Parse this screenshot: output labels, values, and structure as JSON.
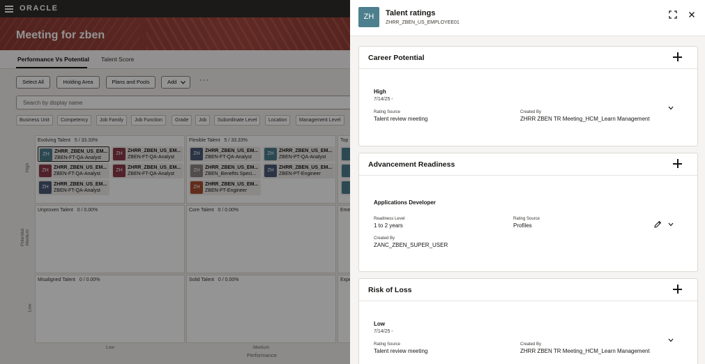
{
  "app": {
    "brand": "ORACLE",
    "page_title": "Meeting for zben"
  },
  "tabs": [
    {
      "label": "Performance Vs Potential"
    },
    {
      "label": "Talent Score"
    }
  ],
  "toolbar": {
    "select_all": "Select All",
    "holding_area": "Holding Area",
    "plans_and_pools": "Plans and Pools",
    "add": "Add",
    "more": "···"
  },
  "search": {
    "placeholder": "Search by display name"
  },
  "filters": [
    "Business Unit",
    "Competency",
    "Job Family",
    "Job Function",
    "Grade",
    "Job",
    "Subordinate Level",
    "Location",
    "Management Level"
  ],
  "grid": {
    "y_axis": "Potential",
    "x_axis": "Performance",
    "rows": [
      "High",
      "Medium",
      "Low"
    ],
    "cols": [
      "Low",
      "Medium"
    ],
    "cells": [
      {
        "label": "Evolving Talent",
        "count": "5 / 33.33%"
      },
      {
        "label": "Flexible Talent",
        "count": "5 / 33.33%"
      },
      {
        "label": "Top"
      },
      {
        "label": "Unproven Talent",
        "count": "0 / 0.00%"
      },
      {
        "label": "Core Talent",
        "count": "0 / 0.00%"
      },
      {
        "label": "Eme"
      },
      {
        "label": "Misaligned Talent",
        "count": "0 / 0.00%"
      },
      {
        "label": "Solid Talent",
        "count": "0 / 0.00%"
      },
      {
        "label": "Expe"
      }
    ],
    "cards": [
      {
        "initials": "ZH",
        "name": "ZHRR_ZBEN_US_EM...",
        "role": "ZBEN-FT-QA-Analyst",
        "color": "#4d7f8e"
      },
      {
        "initials": "ZH",
        "name": "ZHRR_ZBEN_US_EM...",
        "role": "ZBEN-FT-QA-Analyst",
        "color": "#8c3a48"
      },
      {
        "initials": "ZH",
        "name": "ZHRR_ZBEN_US_EM...",
        "role": "ZBEN-FT-QA-Analyst",
        "color": "#8c3a48"
      },
      {
        "initials": "ZH",
        "name": "ZHRR_ZBEN_US_EM...",
        "role": "ZBEN-FT-QA-Analyst",
        "color": "#8c3a48"
      },
      {
        "initials": "ZH",
        "name": "ZHRR_ZBEN_US_EM...",
        "role": "ZBEN-FT-QA-Analyst",
        "color": "#4a5a78"
      },
      {
        "initials": "ZH",
        "name": "ZHRR_ZBEN_US_EM...",
        "role": "ZBEN-FT-QA-Analyst",
        "color": "#4a5a78"
      },
      {
        "initials": "ZH",
        "name": "ZHRR_ZBEN_US_EM...",
        "role": "ZBEN-PT-QA-Analyst",
        "color": "#4d7f8e"
      },
      {
        "initials": "ZH",
        "name": "ZHRR_ZBEN_US_EM...",
        "role": "ZBEN_Benefits Speci...",
        "color": "#8a8580"
      },
      {
        "initials": "ZH",
        "name": "ZHRR_ZBEN_US_EM...",
        "role": "ZBEN-PT-Engineer",
        "color": "#4a5a78"
      },
      {
        "initials": "ZH",
        "name": "ZHRR_ZBEN_US_EM...",
        "role": "ZBEN-PT-Engineer",
        "color": "#a84e2e"
      }
    ]
  },
  "drawer": {
    "avatar": "ZH",
    "title": "Talent ratings",
    "subtitle": "ZHRR_ZBEN_US_EMPLOYEE01",
    "sections": {
      "career": {
        "title": "Career Potential",
        "value": "High",
        "date": "7/14/25 -",
        "rating_source_label": "Rating Source",
        "rating_source": "Talent review meeting",
        "created_by_label": "Created By",
        "created_by": "ZHRR ZBEN TR Meeting_HCM_Learn Management"
      },
      "advancement": {
        "title": "Advancement Readiness",
        "value": "Applications Developer",
        "readiness_label": "Readiness Level",
        "readiness": "1 to 2 years",
        "rating_source_label": "Rating Source",
        "rating_source": "Profiles",
        "created_by_label": "Created By",
        "created_by": "ZANC_ZBEN_SUPER_USER"
      },
      "risk": {
        "title": "Risk of Loss",
        "value": "Low",
        "date": "7/14/25 -",
        "rating_source_label": "Rating Source",
        "rating_source": "Talent review meeting",
        "created_by_label": "Created By",
        "created_by": "ZHRR ZBEN TR Meeting_HCM_Learn Management"
      }
    }
  }
}
